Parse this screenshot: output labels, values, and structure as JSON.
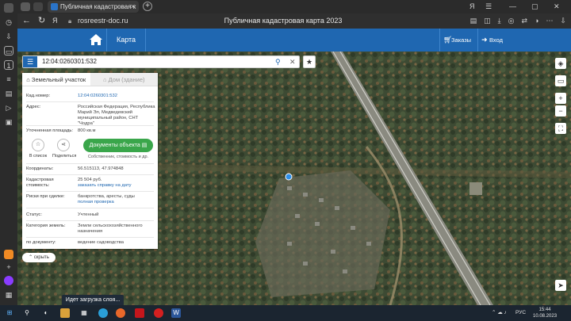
{
  "browser": {
    "tab_title": "Публичная кадастровая к",
    "new_tab": "+",
    "url": "rosreestr-doc.ru",
    "page_title": "Публичная кадастровая карта 2023"
  },
  "header": {
    "map_tab": "Карта",
    "orders": "Заказы",
    "login": "Вход"
  },
  "search": {
    "value": "12:04:0260301:532"
  },
  "panel": {
    "tabs": [
      "Земельный участок",
      "Дом (здание)"
    ],
    "cad_number_label": "Кад.номер:",
    "cad_number": "12:04:0260301:532",
    "address_label": "Адрес:",
    "address": "Российская Федерация, Республика Марий Эл, Медведевский муниципальный район, СНТ \"Чодра\"",
    "area_label": "Уточненная площадь:",
    "area": "800 кв.м",
    "actions": {
      "list": "В список",
      "share": "Поделиться"
    },
    "docs_button": "Документы объекта",
    "docs_sub": "Собственник, стоимость и др.",
    "coords_label": "Координаты:",
    "coords": "56.515113, 47.974848",
    "value_label": "Кадастровая стоимость:",
    "value": "25 504 руб.",
    "value_link": "заказать справку на дату",
    "risks_label": "Риски при сделке:",
    "risks": "банкротства, аресты, суды",
    "risks_link": "полная проверка",
    "status_label": "Статус:",
    "status": "Учтенный",
    "category_label": "Категория земель:",
    "category": "Земли сельскохозяйственного назначения",
    "doc_label": "по документу:",
    "doc": "ведение садоводства"
  },
  "hide_button": "скрыть",
  "map_controls": {
    "zoom_in": "+",
    "zoom_out": "−"
  },
  "toast": "Идет загрузка слоя...",
  "taskbar": {
    "lang": "РУС",
    "time": "15:44",
    "date": "10.08.2023"
  }
}
